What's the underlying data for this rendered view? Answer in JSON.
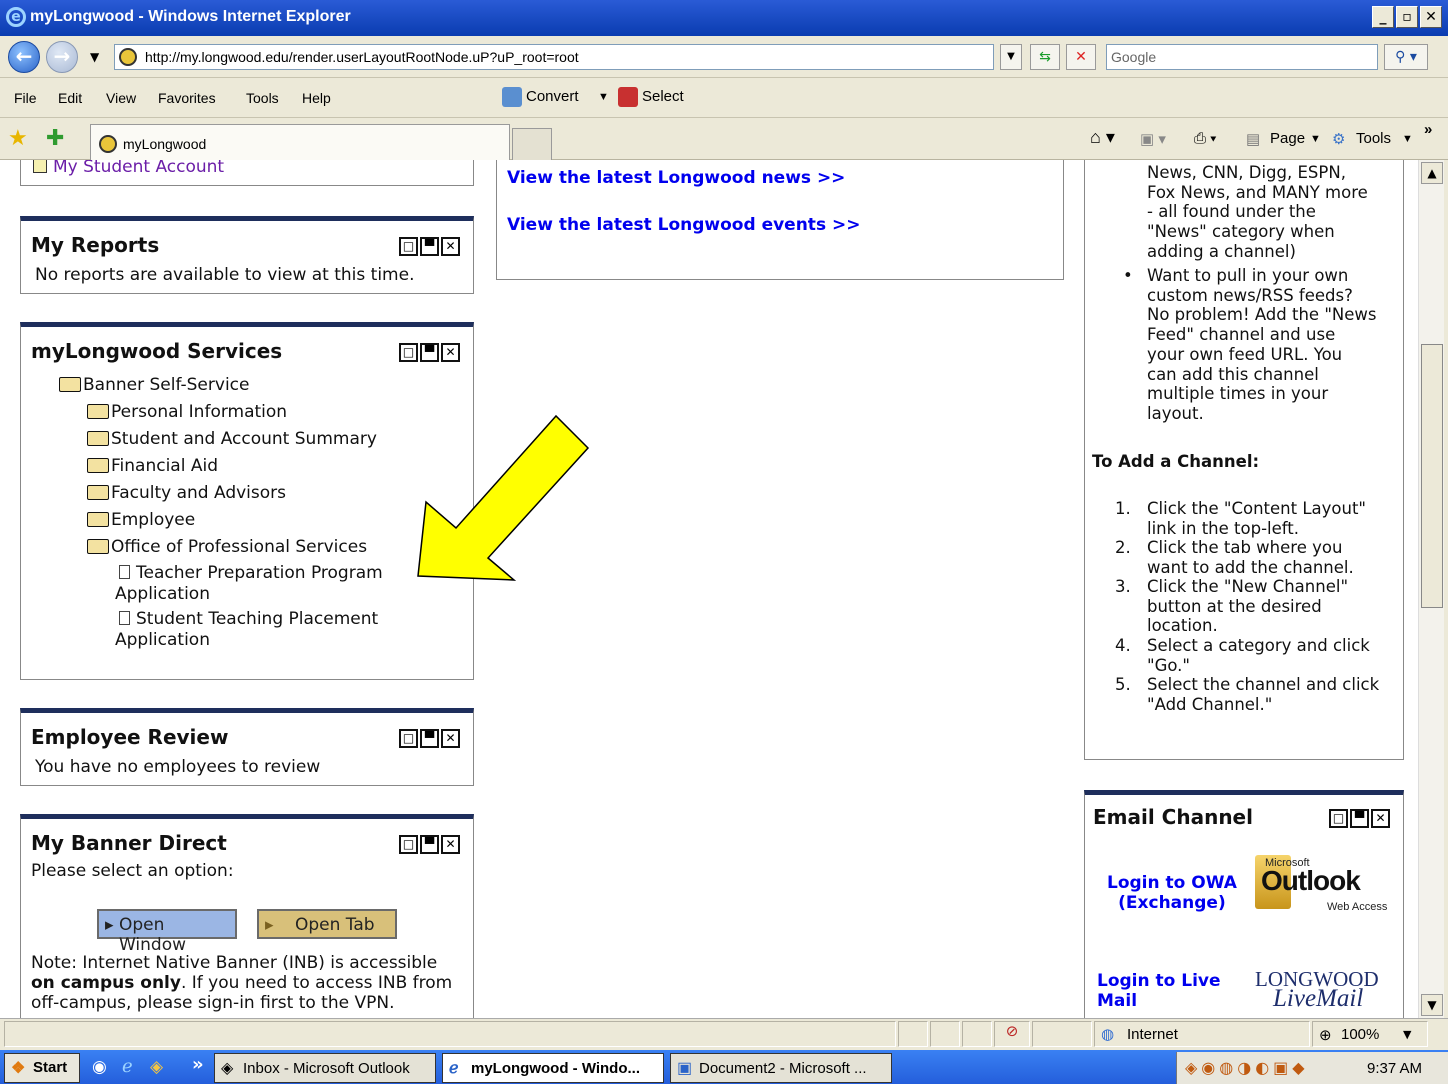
{
  "window": {
    "title": "myLongwood - Windows Internet Explorer"
  },
  "address": {
    "url": "http://my.longwood.edu/render.userLayoutRootNode.uP?uP_root=root",
    "search_placeholder": "Google"
  },
  "menu": {
    "file": "File",
    "edit": "Edit",
    "view": "View",
    "favorites": "Favorites",
    "tools": "Tools",
    "help": "Help",
    "convert": "Convert",
    "select": "Select"
  },
  "tab": {
    "label": "myLongwood"
  },
  "commandbar": {
    "page": "Page",
    "tools": "Tools"
  },
  "left": {
    "student_account_link": "My Student Account",
    "reports": {
      "title": "My Reports",
      "text": "No reports are available to view at this time."
    },
    "services": {
      "title": "myLongwood Services",
      "root": "Banner Self-Service",
      "folders": [
        "Personal Information",
        "Student and Account Summary",
        "Financial Aid",
        "Faculty and Advisors",
        "Employee",
        "Office of Professional Services"
      ],
      "docs": [
        {
          "line1": "Teacher Preparation Program",
          "line2": "Application"
        },
        {
          "line1": "Student Teaching Placement",
          "line2": "Application"
        }
      ]
    },
    "review": {
      "title": "Employee Review",
      "text": "You have no employees to review"
    },
    "banner": {
      "title": "My Banner Direct",
      "prompt": "Please select an option:",
      "open_window": "Open Window",
      "open_tab": "Open Tab",
      "note_pre": "Note: Internet Native Banner (INB) is accessible",
      "note_bold": "on campus only",
      "note_mid": ". If you need to access INB from",
      "note_end": "off-campus, please sign-in first to the VPN."
    }
  },
  "center": {
    "news_link": "View the latest Longwood news >>",
    "events_link": "View the latest Longwood events >>"
  },
  "right": {
    "bullet1_lines": [
      "News, CNN, Digg, ESPN,",
      "Fox News, and MANY more",
      "- all found under the",
      "\"News\" category when",
      "adding a channel)"
    ],
    "bullet2_lines": [
      "Want to pull in your own",
      "custom news/RSS feeds?",
      "No problem! Add the \"News",
      "Feed\" channel and use",
      "your own feed URL. You",
      "can add this channel",
      "multiple times in your",
      "layout."
    ],
    "add_heading": "To Add a Channel:",
    "steps": [
      {
        "num": "1.",
        "lines": [
          "Click the \"Content Layout\"",
          "link in the top-left."
        ]
      },
      {
        "num": "2.",
        "lines": [
          "Click the tab where you",
          "want to add the channel."
        ]
      },
      {
        "num": "3.",
        "lines": [
          "Click the \"New Channel\"",
          "button at the desired",
          "location."
        ]
      },
      {
        "num": "4.",
        "lines": [
          "Select a category and click",
          "\"Go.\""
        ]
      },
      {
        "num": "5.",
        "lines": [
          "Select the channel and click",
          "\"Add Channel.\""
        ]
      }
    ],
    "email": {
      "title": "Email Channel",
      "owa_line1": "Login to OWA",
      "owa_line2": "(Exchange)",
      "outlook_top": "Microsoft",
      "outlook_main": "Outlook",
      "outlook_sub": "Web Access",
      "live_line1": "Login to Live",
      "live_line2": "Mail",
      "longwood_top": "LONGWOOD",
      "longwood_sub": "LiveMail"
    }
  },
  "status": {
    "zone": "Internet",
    "zoom": "100%"
  },
  "taskbar": {
    "start": "Start",
    "tasks": [
      "Inbox - Microsoft Outlook",
      "myLongwood - Windo...",
      "Document2 - Microsoft ..."
    ],
    "clock": "9:37 AM"
  },
  "colors": {
    "channel_border_top": "#1e2e5c",
    "link": "#0000ee",
    "arrow": "#ffff00",
    "title_bar": "#0a3cb0"
  }
}
